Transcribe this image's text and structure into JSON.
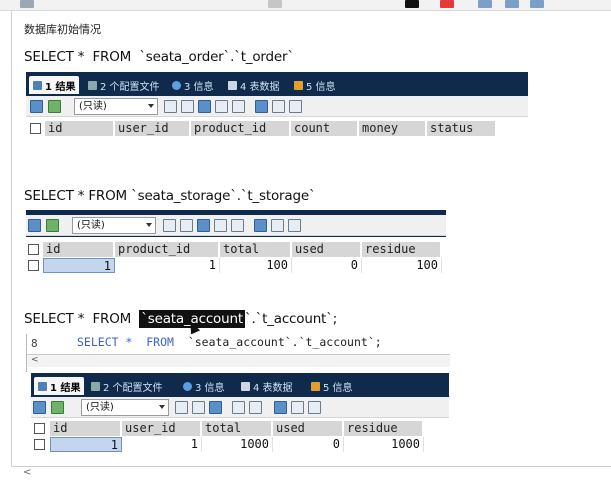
{
  "page": {
    "heading": "数据库初始情况"
  },
  "queries": [
    {
      "sql": "SELECT *  FROM  `seata_order`.`t_order`"
    },
    {
      "sql": "SELECT * FROM `seata_storage`.`t_storage`"
    },
    {
      "sql_prefix": "SELECT *  FROM  ",
      "sql_highlight": "`seata_account",
      "sql_suffix": "`.`t_account`;"
    }
  ],
  "editor": {
    "line_number": "8",
    "kw1": "SELECT *",
    "kw2": "FROM",
    "code_rest": "`seata_account`.`t_account`;",
    "scroll_left": "<"
  },
  "tabs": [
    {
      "label": "1 结果"
    },
    {
      "label": "2 个配置文件"
    },
    {
      "label": "3 信息"
    },
    {
      "label": "4 表数据"
    },
    {
      "label": "5 信息"
    }
  ],
  "toolbar": {
    "mode_select": "(只读)"
  },
  "tables": [
    {
      "columns": [
        "id",
        "user_id",
        "product_id",
        "count",
        "money",
        "status"
      ],
      "rows": []
    },
    {
      "columns": [
        "id",
        "product_id",
        "total",
        "used",
        "residue"
      ],
      "rows": [
        [
          "1",
          "1",
          "100",
          "0",
          "100"
        ]
      ]
    },
    {
      "columns": [
        "id",
        "user_id",
        "total",
        "used",
        "residue"
      ],
      "rows": [
        [
          "1",
          "1",
          "1000",
          "0",
          "1000"
        ]
      ]
    }
  ],
  "bottom": {
    "scroll_left": "<"
  },
  "colors": {
    "panel_bg": "#0f2a4a",
    "selected_cell": "#c3d6ee",
    "header_cell": "#d6d6d6"
  }
}
